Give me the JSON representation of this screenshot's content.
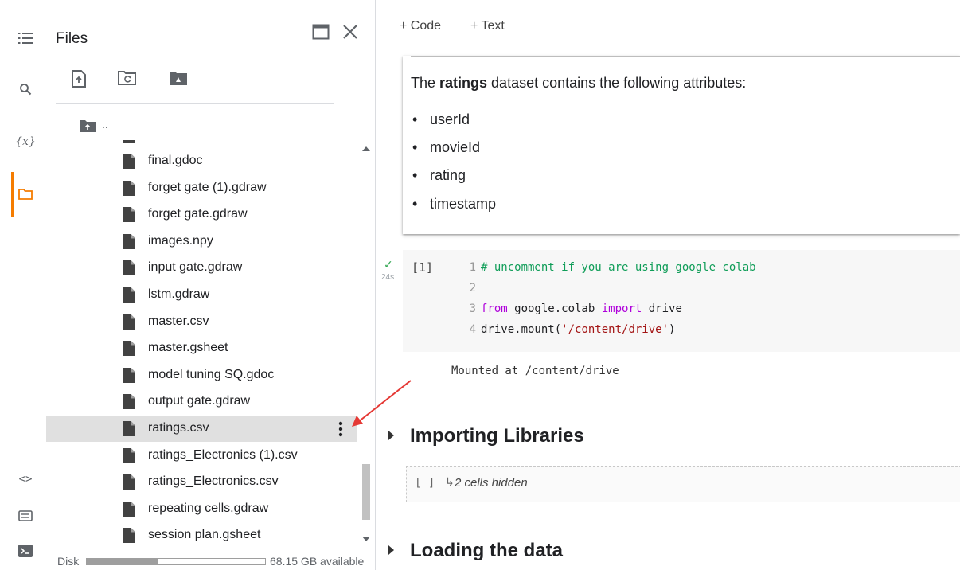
{
  "sidebar": {
    "title": "Files",
    "up_folder_label": "..",
    "files": [
      "final.gdoc",
      "forget gate (1).gdraw",
      "forget gate.gdraw",
      "images.npy",
      "input gate.gdraw",
      "lstm.gdraw",
      "master.csv",
      "master.gsheet",
      "model tuning SQ.gdoc",
      "output gate.gdraw",
      "ratings.csv",
      "ratings_Electronics (1).csv",
      "ratings_Electronics.csv",
      "repeating cells.gdraw",
      "session plan.gsheet"
    ],
    "selected_file": "ratings.csv",
    "disk": {
      "label": "Disk",
      "available": "68.15 GB available",
      "used_fraction": 0.4
    }
  },
  "rail": {
    "icons": [
      "table-of-contents-icon",
      "search-icon",
      "variables-icon",
      "files-folder-icon",
      "code-snippets-icon",
      "command-palette-icon",
      "terminal-icon"
    ],
    "variables_glyph": "{x}",
    "code_snippets_glyph": "<>",
    "accent_color": "#f57c00"
  },
  "toolbar": {
    "add_code": "+ Code",
    "add_text": "+ Text"
  },
  "markdown_cell": {
    "intro_prefix": "The ",
    "intro_bold": "ratings",
    "intro_suffix": " dataset contains the following attributes:",
    "attributes": [
      "userId",
      "movieId",
      "rating",
      "timestamp"
    ]
  },
  "code_cell": {
    "execution_count": "[1]",
    "run_time": "24s",
    "line_numbers": [
      "1",
      "2",
      "3",
      "4"
    ],
    "line1_comment": "# uncomment if you are using google colab",
    "line3_from": "from",
    "line3_module": " google.colab ",
    "line3_import": "import",
    "line3_name": " drive",
    "line4_prefix": "drive.mount(",
    "line4_quote_open": "'",
    "line4_path": "/content/drive",
    "line4_quote_close": "'",
    "line4_suffix": ")",
    "output": "Mounted at /content/drive"
  },
  "sections": {
    "importing": "Importing Libraries",
    "hidden_brackets": "[ ]",
    "hidden_arrow": "↳",
    "hidden_text": "2 cells hidden",
    "loading": "Loading the data"
  }
}
